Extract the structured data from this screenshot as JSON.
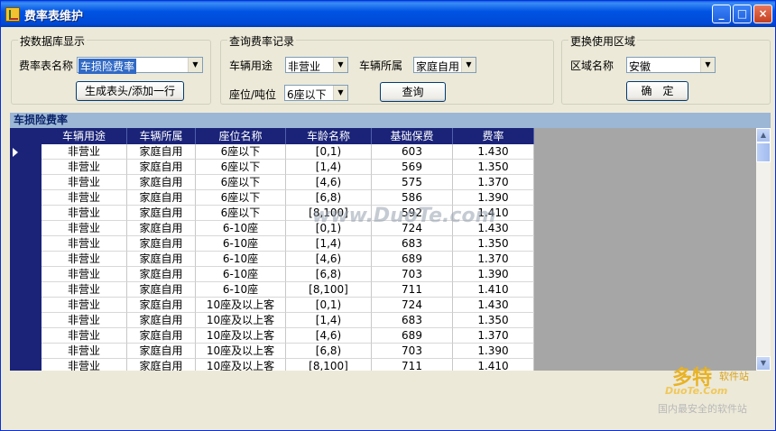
{
  "window": {
    "title": "费率表维护"
  },
  "title_buttons": {
    "minimize": "_",
    "maximize": "□",
    "close": "×"
  },
  "db_group": {
    "title": "按数据库显示",
    "table_label": "费率表名称",
    "table_value": "车损险费率",
    "generate_button": "生成表头/添加一行"
  },
  "query_group": {
    "title": "查询费率记录",
    "usage_label": "车辆用途",
    "usage_value": "非营业",
    "owner_label": "车辆所属",
    "owner_value": "家庭自用",
    "seat_label": "座位/吨位",
    "seat_value": "6座以下",
    "query_button": "查询"
  },
  "region_group": {
    "title": "更换使用区域",
    "region_label": "区域名称",
    "region_value": "安徽",
    "confirm_button": "确　定"
  },
  "grid": {
    "caption": "车损险费率",
    "columns": [
      "车辆用途",
      "车辆所属",
      "座位名称",
      "车龄名称",
      "基础保费",
      "费率"
    ],
    "rows": [
      [
        "非营业",
        "家庭自用",
        "6座以下",
        "[0,1)",
        "603",
        "1.430"
      ],
      [
        "非营业",
        "家庭自用",
        "6座以下",
        "[1,4)",
        "569",
        "1.350"
      ],
      [
        "非营业",
        "家庭自用",
        "6座以下",
        "[4,6)",
        "575",
        "1.370"
      ],
      [
        "非营业",
        "家庭自用",
        "6座以下",
        "[6,8)",
        "586",
        "1.390"
      ],
      [
        "非营业",
        "家庭自用",
        "6座以下",
        "[8,100]",
        "592",
        "1.410"
      ],
      [
        "非营业",
        "家庭自用",
        "6-10座",
        "[0,1)",
        "724",
        "1.430"
      ],
      [
        "非营业",
        "家庭自用",
        "6-10座",
        "[1,4)",
        "683",
        "1.350"
      ],
      [
        "非营业",
        "家庭自用",
        "6-10座",
        "[4,6)",
        "689",
        "1.370"
      ],
      [
        "非营业",
        "家庭自用",
        "6-10座",
        "[6,8)",
        "703",
        "1.390"
      ],
      [
        "非营业",
        "家庭自用",
        "6-10座",
        "[8,100]",
        "711",
        "1.410"
      ],
      [
        "非营业",
        "家庭自用",
        "10座及以上客",
        "[0,1)",
        "724",
        "1.430"
      ],
      [
        "非营业",
        "家庭自用",
        "10座及以上客",
        "[1,4)",
        "683",
        "1.350"
      ],
      [
        "非营业",
        "家庭自用",
        "10座及以上客",
        "[4,6)",
        "689",
        "1.370"
      ],
      [
        "非营业",
        "家庭自用",
        "10座及以上客",
        "[6,8)",
        "703",
        "1.390"
      ],
      [
        "非营业",
        "家庭自用",
        "10座及以上客",
        "[8,100]",
        "711",
        "1.410"
      ]
    ]
  },
  "watermark": {
    "center": "www.DuoTe.com",
    "logo_cn": "多特",
    "logo_sub": "软件站",
    "logo_en": "DuoTe.Com",
    "logo_tag": "国内最安全的软件站"
  },
  "icons": {
    "dropdown": "chevron-down-icon",
    "row_marker": "current-row-arrow-icon",
    "scroll_up": "scroll-up-arrow-icon",
    "scroll_down": "scroll-down-arrow-icon"
  },
  "colors": {
    "titlebar": "#0054e3",
    "grid_header": "#1a2378",
    "grid_caption": "#9cb6d6"
  }
}
